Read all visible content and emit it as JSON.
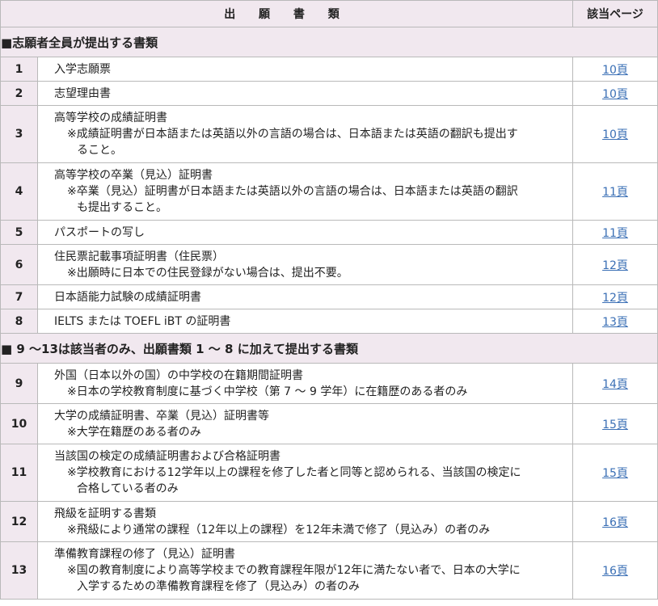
{
  "header": {
    "document": "出 願 書 類",
    "page": "該当ページ"
  },
  "section1": {
    "title": "■志願者全員が提出する書類"
  },
  "section2": {
    "title": "■ 9 ～13は該当者のみ、出願書類 1 ～ 8 に加えて提出する書類"
  },
  "rows": [
    {
      "num": "1",
      "title": "入学志願票",
      "note": "",
      "page": "10頁"
    },
    {
      "num": "2",
      "title": "志望理由書",
      "note": "",
      "page": "10頁"
    },
    {
      "num": "3",
      "title": "高等学校の成績証明書",
      "note": "※成績証明書が日本語または英語以外の言語の場合は、日本語または英語の翻訳も提出す",
      "note2": "ること。",
      "page": "10頁"
    },
    {
      "num": "4",
      "title": "高等学校の卒業（見込）証明書",
      "note": "※卒業（見込）証明書が日本語または英語以外の言語の場合は、日本語または英語の翻訳",
      "note2": "も提出すること。",
      "page": "11頁"
    },
    {
      "num": "5",
      "title": "パスポートの写し",
      "note": "",
      "page": "11頁"
    },
    {
      "num": "6",
      "title": "住民票記載事項証明書（住民票）",
      "note": "※出願時に日本での住民登録がない場合は、提出不要。",
      "page": "12頁"
    },
    {
      "num": "7",
      "title": "日本語能力試験の成績証明書",
      "note": "",
      "page": "12頁"
    },
    {
      "num": "8",
      "title": "IELTS または TOEFL iBT の証明書",
      "note": "",
      "page": "13頁"
    },
    {
      "num": "9",
      "title": "外国（日本以外の国）の中学校の在籍期間証明書",
      "note": "※日本の学校教育制度に基づく中学校（第 7 ～ 9 学年）に在籍歴のある者のみ",
      "page": "14頁"
    },
    {
      "num": "10",
      "title": "大学の成績証明書、卒業（見込）証明書等",
      "note": "※大学在籍歴のある者のみ",
      "page": "15頁"
    },
    {
      "num": "11",
      "title": "当該国の検定の成績証明書および合格証明書",
      "note": "※学校教育における12学年以上の課程を修了した者と同等と認められる、当該国の検定に",
      "note2": "合格している者のみ",
      "page": "15頁"
    },
    {
      "num": "12",
      "title": "飛級を証明する書類",
      "note": "※飛級により通常の課程（12年以上の課程）を12年未満で修了（見込み）の者のみ",
      "page": "16頁"
    },
    {
      "num": "13",
      "title": "準備教育課程の修了（見込）証明書",
      "note": "※国の教育制度により高等学校までの教育課程年限が12年に満たない者で、日本の大学に",
      "note2": "入学するための準備教育課程を修了（見込み）の者のみ",
      "page": "16頁"
    }
  ]
}
